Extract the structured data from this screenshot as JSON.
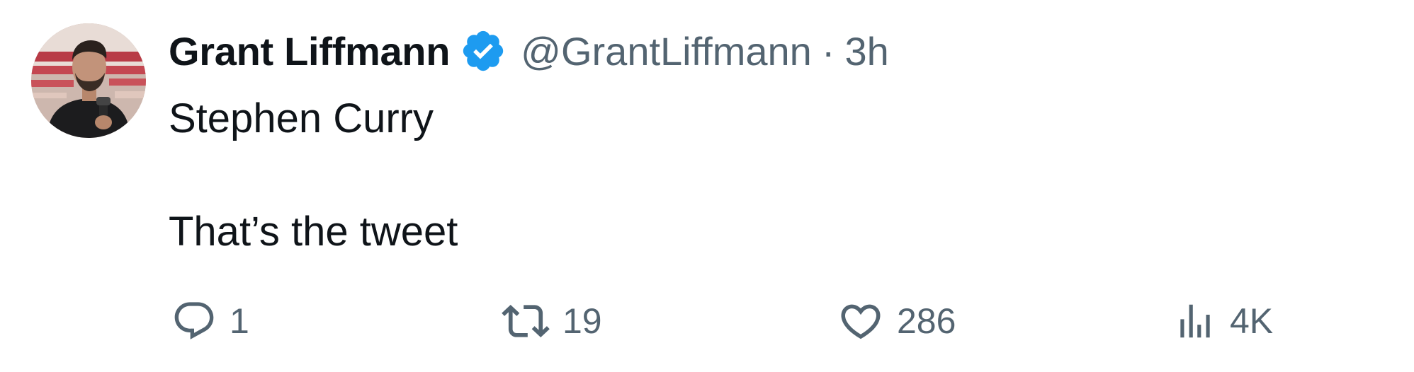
{
  "tweet": {
    "author": {
      "display_name": "Grant Liffmann",
      "verified": true,
      "handle": "@GrantLiffmann",
      "separator": "·",
      "time": "3h"
    },
    "text_lines": [
      "Stephen Curry",
      "",
      "That’s the tweet"
    ],
    "actions": {
      "reply": {
        "icon": "reply-icon",
        "count": "1"
      },
      "retweet": {
        "icon": "retweet-icon",
        "count": "19"
      },
      "like": {
        "icon": "heart-icon",
        "count": "286"
      },
      "views": {
        "icon": "views-icon",
        "count": "4K"
      }
    }
  },
  "colors": {
    "text_primary": "#0f1419",
    "text_secondary": "#536471",
    "verified_badge": "#1d9bf0"
  }
}
